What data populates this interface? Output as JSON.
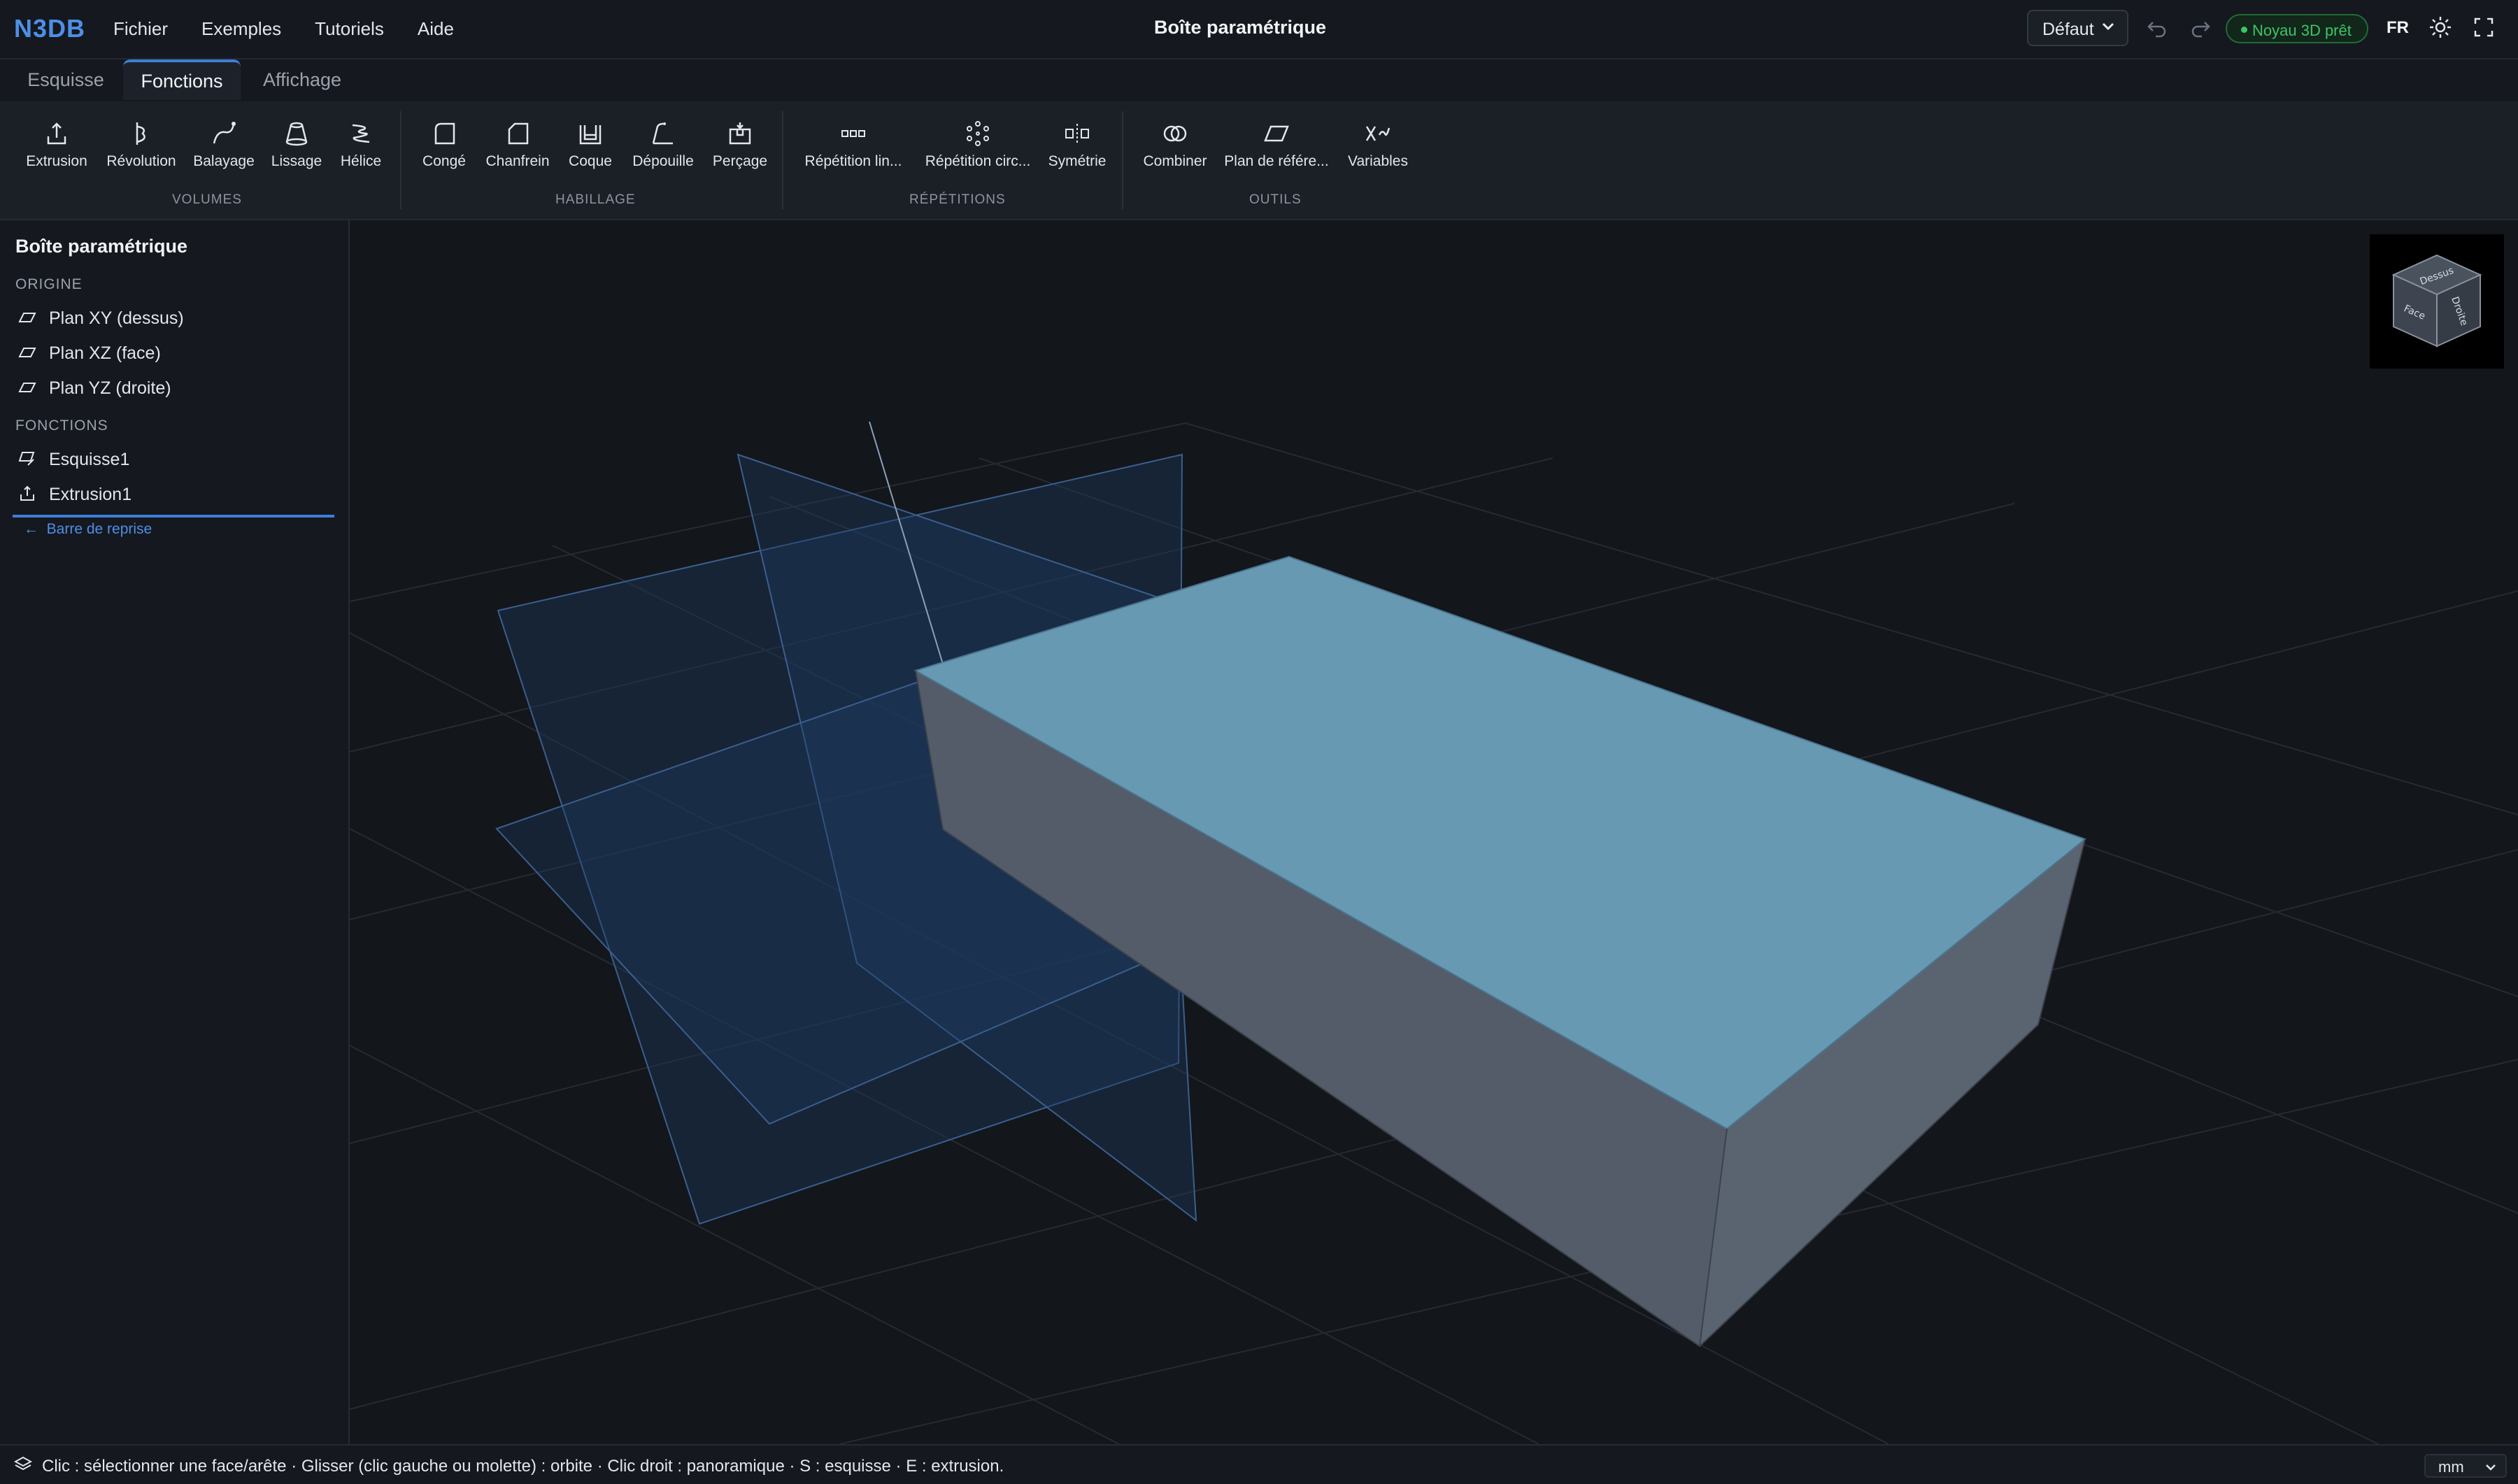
{
  "app": {
    "logo": "N3DB",
    "menu": [
      "Fichier",
      "Exemples",
      "Tutoriels",
      "Aide"
    ],
    "document_title": "Boîte paramétrique",
    "preset": "Défaut",
    "kernel_status": "Noyau 3D prêt",
    "language": "FR"
  },
  "tabs": [
    {
      "label": "Esquisse",
      "active": false
    },
    {
      "label": "Fonctions",
      "active": true
    },
    {
      "label": "Affichage",
      "active": false
    }
  ],
  "ribbon": {
    "groups": [
      {
        "label": "VOLUMES",
        "tools": [
          "Extrusion",
          "Révolution",
          "Balayage",
          "Lissage",
          "Hélice"
        ]
      },
      {
        "label": "HABILLAGE",
        "tools": [
          "Congé",
          "Chanfrein",
          "Coque",
          "Dépouille",
          "Perçage"
        ]
      },
      {
        "label": "RÉPÉTITIONS",
        "tools": [
          "Répétition lin...",
          "Répétition circ...",
          "Symétrie"
        ]
      },
      {
        "label": "OUTILS",
        "tools": [
          "Combiner",
          "Plan de référe...",
          "Variables"
        ]
      }
    ]
  },
  "tree": {
    "title": "Boîte paramétrique",
    "origin_label": "ORIGINE",
    "origin_items": [
      "Plan XY (dessus)",
      "Plan XZ (face)",
      "Plan YZ (droite)"
    ],
    "features_label": "FONCTIONS",
    "feature_items": [
      "Esquisse1",
      "Extrusion1"
    ],
    "rollback_label": "Barre de reprise"
  },
  "viewcube": {
    "faces": [
      "Dessus",
      "Face",
      "Droite"
    ]
  },
  "statusbar": {
    "hint": "Clic : sélectionner une face/arête · Glisser (clic gauche ou molette) : orbite · Clic droit : panoramique · S : esquisse · E : extrusion.",
    "unit": "mm"
  },
  "colors": {
    "accent": "#3d7fd9",
    "box_top": "#6899b3",
    "box_front": "#535c68",
    "box_side": "#5a6470",
    "status_green": "#3cc46b"
  }
}
